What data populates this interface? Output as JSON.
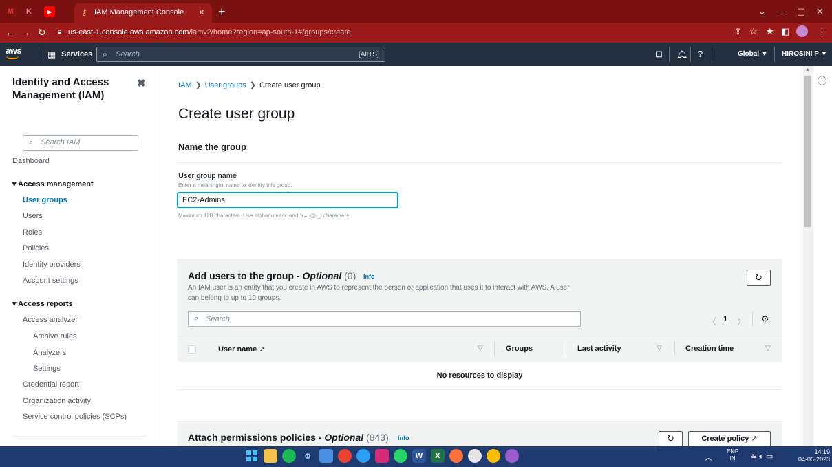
{
  "browser": {
    "tab_title": "IAM Management Console",
    "tab_close": "×",
    "new_tab": "+",
    "url_host": "us-east-1.console.aws.amazon.com",
    "url_path": "/iamv2/home?region=ap-south-1#/groups/create",
    "favicons": [
      "M",
      "K",
      "▶"
    ]
  },
  "aws_nav": {
    "logo": "aws",
    "services": "Services",
    "search_placeholder": "Search",
    "search_shortcut": "[Alt+S]",
    "region": "Global ▼",
    "user": "HIROSINI P ▼"
  },
  "sidebar": {
    "title": "Identity and Access Management (IAM)",
    "search_placeholder": "Search IAM",
    "dashboard": "Dashboard",
    "access_management": "Access management",
    "am_items": [
      "User groups",
      "Users",
      "Roles",
      "Policies",
      "Identity providers",
      "Account settings"
    ],
    "access_reports": "Access reports",
    "ar_items": [
      "Access analyzer",
      "Archive rules",
      "Analyzers",
      "Settings",
      "Credential report",
      "Organization activity",
      "Service control policies (SCPs)"
    ]
  },
  "breadcrumb": {
    "iam": "IAM",
    "user_groups": "User groups",
    "current": "Create user group"
  },
  "page": {
    "title": "Create user group",
    "section_name": "Name the group",
    "field_label": "User group name",
    "field_desc": "Enter a meaningful name to identify this group.",
    "field_value": "EC2-Admins",
    "field_hint": "Maximum 128 characters. Use alphanumeric and '+=,.@-_' characters."
  },
  "add_users": {
    "title": "Add users to the group - ",
    "optional": "Optional",
    "count": " (0)",
    "info": "Info",
    "description": "An IAM user is an entity that you create in AWS to represent the person or application that uses it to interact with AWS. A user can belong to up to 10 groups.",
    "search_placeholder": "Search",
    "page_number": "1",
    "columns": [
      "User name",
      "Groups",
      "Last activity",
      "Creation time"
    ],
    "empty": "No resources to display"
  },
  "attach_policies": {
    "title": "Attach permissions policies - ",
    "optional": "Optional",
    "count": " (843)",
    "info": "Info",
    "create_policy": "Create policy"
  },
  "taskbar": {
    "lang_top": "ENG",
    "lang_bottom": "IN",
    "time": "14:19",
    "date": "04-05-2023"
  },
  "colors": {
    "browser_frame": "#7b1212",
    "aws_nav": "#232f3e",
    "link": "#0073bb",
    "focus": "#00a1c9",
    "taskbar": "#1f3a6e"
  }
}
